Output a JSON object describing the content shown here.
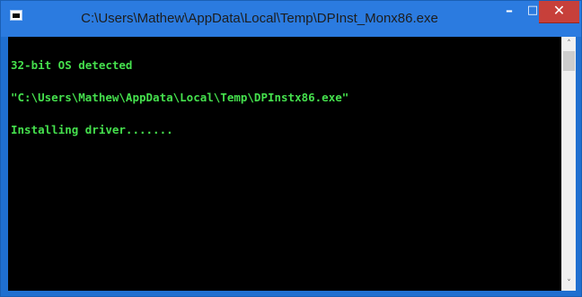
{
  "window": {
    "title": "C:\\Users\\Mathew\\AppData\\Local\\Temp\\DPInst_Monx86.exe",
    "buttons": {
      "minimize": "–",
      "maximize": "□",
      "close": "✕"
    },
    "app_icon": "console-app-icon"
  },
  "console": {
    "lines": [
      "32-bit OS detected",
      "\"C:\\Users\\Mathew\\AppData\\Local\\Temp\\DPInstx86.exe\"",
      "Installing driver......."
    ],
    "text_color": "#45e04d",
    "background": "#000000"
  },
  "scrollbar": {
    "up_arrow": "˄",
    "down_arrow": "˅"
  },
  "colors": {
    "frame": "#2b7be0",
    "close_button": "#c7403a"
  }
}
